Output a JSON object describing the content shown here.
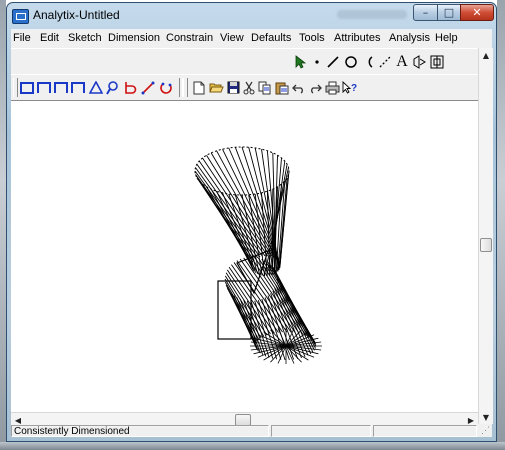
{
  "window": {
    "title": "Analytix-Untitled",
    "controls": {
      "minimize": "–",
      "maximize": "□",
      "close": "✕"
    }
  },
  "menu": [
    "File",
    "Edit",
    "Sketch",
    "Dimension",
    "Constrain",
    "View",
    "Defaults",
    "Tools",
    "Attributes",
    "Analysis",
    "Help"
  ],
  "draw_tools": [
    "select-arrow",
    "point",
    "line",
    "circle",
    "arc",
    "construction-line",
    "text",
    "dimension",
    "fit"
  ],
  "text_tool_glyph": "A",
  "sketch_tools": [
    "rectangle",
    "three-side-frame",
    "three-side-frame",
    "three-side-frame",
    "triangle",
    "magnifier",
    "slot",
    "line-segment",
    "circle-arc"
  ],
  "file_tools": [
    "new-file",
    "open-folder",
    "save",
    "cut",
    "copy",
    "paste",
    "undo",
    "redo",
    "print",
    "help-pointer"
  ],
  "status": {
    "text": "Consistently Dimensioned",
    "pane2": "",
    "pane3": ""
  },
  "colors": {
    "accent": "#1b39c7",
    "red": "#d01010",
    "drawing": "#000000"
  }
}
